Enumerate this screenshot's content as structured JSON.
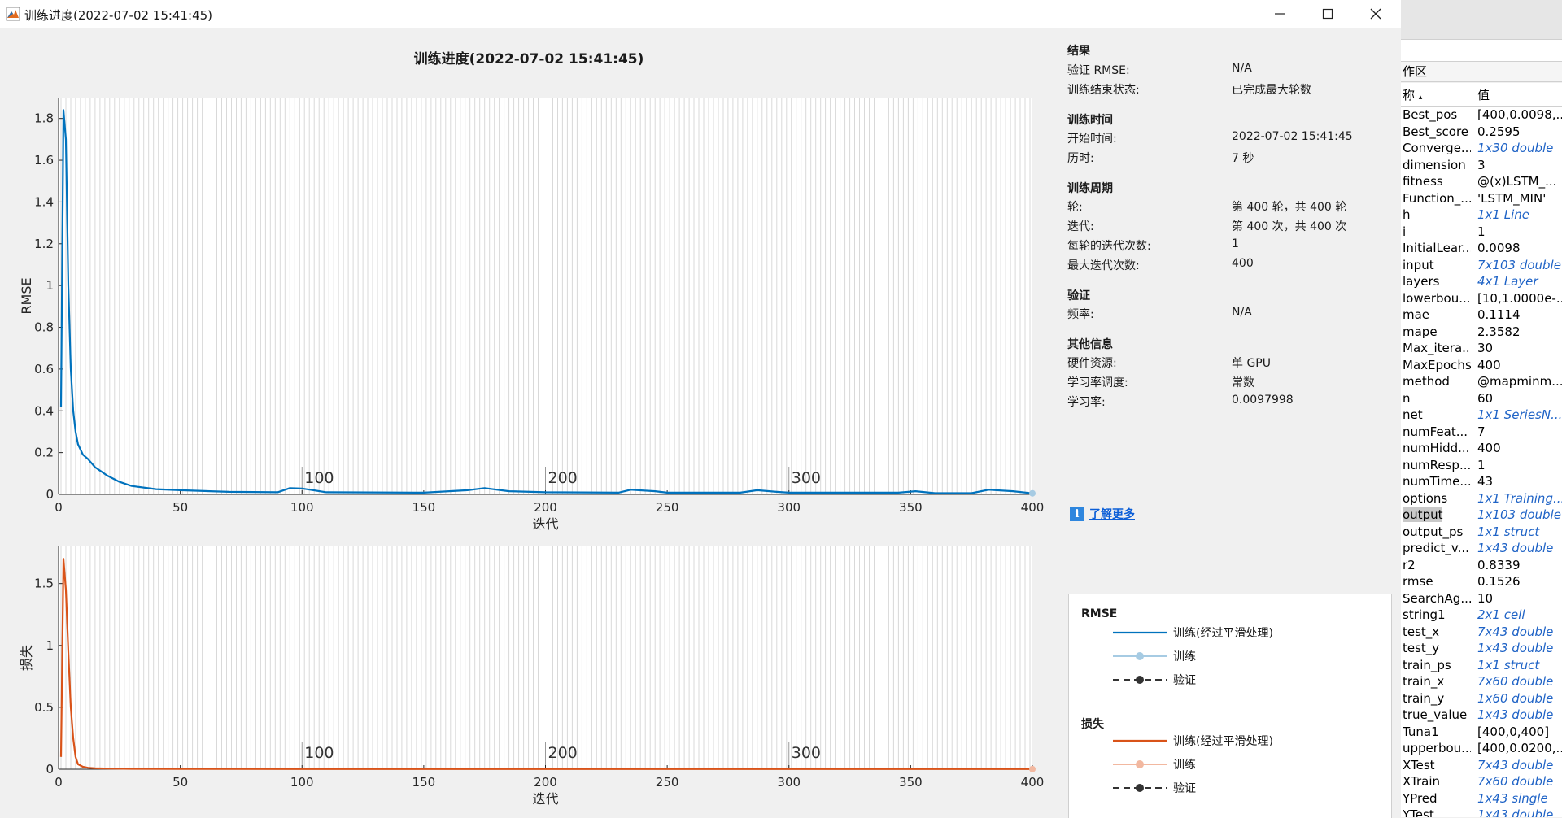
{
  "window": {
    "title": "训练进度(2022-07-02 15:41:45)",
    "controls": [
      "minimize",
      "maximize",
      "close"
    ]
  },
  "figure_title": "训练进度(2022-07-02 15:41:45)",
  "info_panel": {
    "sections": [
      {
        "title": "结果",
        "rows": [
          {
            "label": "验证 RMSE:",
            "value": "N/A"
          },
          {
            "label": "训练结束状态:",
            "value": "已完成最大轮数"
          }
        ]
      },
      {
        "title": "训练时间",
        "rows": [
          {
            "label": "开始时间:",
            "value": "2022-07-02 15:41:45"
          },
          {
            "label": "历时:",
            "value": "7 秒"
          }
        ]
      },
      {
        "title": "训练周期",
        "rows": [
          {
            "label": "轮:",
            "value": "第 400 轮，共 400 轮"
          },
          {
            "label": "迭代:",
            "value": "第 400 次，共 400 次"
          },
          {
            "label": "每轮的迭代次数:",
            "value": "1"
          },
          {
            "label": "最大迭代次数:",
            "value": "400"
          }
        ]
      },
      {
        "title": "验证",
        "rows": [
          {
            "label": "频率:",
            "value": "N/A"
          }
        ]
      },
      {
        "title": "其他信息",
        "rows": [
          {
            "label": "硬件资源:",
            "value": "单 GPU"
          },
          {
            "label": "学习率调度:",
            "value": "常数"
          },
          {
            "label": "学习率:",
            "value": "0.0097998"
          }
        ]
      }
    ],
    "learn_more": "了解更多"
  },
  "legend": {
    "groups": [
      {
        "title": "RMSE",
        "items": [
          {
            "label": "训练(经过平滑处理)",
            "style": "line",
            "color": "#0072bd"
          },
          {
            "label": "训练",
            "style": "line-marker",
            "color": "#a6cbe3"
          },
          {
            "label": "验证",
            "style": "dashed-marker",
            "color": "#333333"
          }
        ]
      },
      {
        "title": "损失",
        "items": [
          {
            "label": "训练(经过平滑处理)",
            "style": "line",
            "color": "#d95319"
          },
          {
            "label": "训练",
            "style": "line-marker",
            "color": "#f2b8a0"
          },
          {
            "label": "验证",
            "style": "dashed-marker",
            "color": "#333333"
          }
        ]
      }
    ]
  },
  "chart_data": [
    {
      "type": "line",
      "ylabel": "RMSE",
      "xlabel": "迭代",
      "xlim": [
        0,
        400
      ],
      "ylim": [
        0,
        1.9
      ],
      "xticks": [
        0,
        50,
        100,
        150,
        200,
        250,
        300,
        350,
        400
      ],
      "yticks": [
        0,
        0.2,
        0.4,
        0.6,
        0.8,
        1,
        1.2,
        1.4,
        1.6,
        1.8
      ],
      "ytick_labels": [
        "0",
        "0.2",
        "0.4",
        "0.6",
        "0.8",
        "1",
        "1.2",
        "1.4",
        "1.6",
        "1.8"
      ],
      "epoch_markers": [
        {
          "x": 100,
          "label": "100"
        },
        {
          "x": 200,
          "label": "200"
        },
        {
          "x": 300,
          "label": "300"
        }
      ],
      "series": [
        {
          "name": "训练(经过平滑处理)",
          "color": "#0072bd",
          "x": [
            1,
            2,
            3,
            4,
            5,
            6,
            7,
            8,
            10,
            12,
            15,
            20,
            25,
            30,
            40,
            50,
            70,
            90,
            95,
            100,
            110,
            150,
            168,
            175,
            185,
            200,
            230,
            235,
            245,
            250,
            280,
            287,
            295,
            300,
            345,
            352,
            360,
            375,
            382,
            392,
            400
          ],
          "y": [
            0.42,
            1.84,
            1.7,
            1.0,
            0.6,
            0.4,
            0.3,
            0.24,
            0.19,
            0.17,
            0.13,
            0.09,
            0.06,
            0.04,
            0.025,
            0.02,
            0.012,
            0.01,
            0.03,
            0.028,
            0.01,
            0.008,
            0.02,
            0.03,
            0.015,
            0.01,
            0.008,
            0.022,
            0.015,
            0.008,
            0.008,
            0.02,
            0.012,
            0.008,
            0.008,
            0.015,
            0.006,
            0.006,
            0.022,
            0.015,
            0.005
          ]
        }
      ]
    },
    {
      "type": "line",
      "ylabel": "损失",
      "xlabel": "迭代",
      "xlim": [
        0,
        400
      ],
      "ylim": [
        0,
        1.8
      ],
      "xticks": [
        0,
        50,
        100,
        150,
        200,
        250,
        300,
        350,
        400
      ],
      "yticks": [
        0,
        0.5,
        1,
        1.5
      ],
      "ytick_labels": [
        "0",
        "0.5",
        "1",
        "1.5"
      ],
      "epoch_markers": [
        {
          "x": 100,
          "label": "100"
        },
        {
          "x": 200,
          "label": "200"
        },
        {
          "x": 300,
          "label": "300"
        }
      ],
      "series": [
        {
          "name": "训练(经过平滑处理)",
          "color": "#d95319",
          "x": [
            1,
            2,
            3,
            4,
            5,
            6,
            7,
            8,
            10,
            12,
            15,
            20,
            30,
            50,
            400
          ],
          "y": [
            0.1,
            1.7,
            1.45,
            0.95,
            0.5,
            0.25,
            0.1,
            0.04,
            0.02,
            0.012,
            0.008,
            0.005,
            0.003,
            0.002,
            0.001
          ]
        }
      ]
    }
  ],
  "workspace": {
    "title": "作区",
    "col_name": "称",
    "col_value": "值",
    "variables": [
      {
        "name": "Best_pos",
        "value": "[400,0.0098,...",
        "class_ref": false
      },
      {
        "name": "Best_score",
        "value": "0.2595",
        "class_ref": false
      },
      {
        "name": "Converge...",
        "value": "1x30 double",
        "class_ref": true
      },
      {
        "name": "dimension",
        "value": "3",
        "class_ref": false
      },
      {
        "name": "fitness",
        "value": "@(x)LSTM_...",
        "class_ref": false
      },
      {
        "name": "Function_...",
        "value": "'LSTM_MIN'",
        "class_ref": false
      },
      {
        "name": "h",
        "value": "1x1 Line",
        "class_ref": true
      },
      {
        "name": "i",
        "value": "1",
        "class_ref": false
      },
      {
        "name": "InitialLear...",
        "value": "0.0098",
        "class_ref": false
      },
      {
        "name": "input",
        "value": "7x103 double",
        "class_ref": true
      },
      {
        "name": "layers",
        "value": "4x1 Layer",
        "class_ref": true
      },
      {
        "name": "lowerbou...",
        "value": "[10,1.0000e-...",
        "class_ref": false
      },
      {
        "name": "mae",
        "value": "0.1114",
        "class_ref": false
      },
      {
        "name": "mape",
        "value": "2.3582",
        "class_ref": false
      },
      {
        "name": "Max_itera...",
        "value": "30",
        "class_ref": false
      },
      {
        "name": "MaxEpochs",
        "value": "400",
        "class_ref": false
      },
      {
        "name": "method",
        "value": "@mapminm...",
        "class_ref": false
      },
      {
        "name": "n",
        "value": "60",
        "class_ref": false
      },
      {
        "name": "net",
        "value": "1x1 SeriesN...",
        "class_ref": true
      },
      {
        "name": "numFeat...",
        "value": "7",
        "class_ref": false
      },
      {
        "name": "numHidd...",
        "value": "400",
        "class_ref": false
      },
      {
        "name": "numResp...",
        "value": "1",
        "class_ref": false
      },
      {
        "name": "numTime...",
        "value": "43",
        "class_ref": false
      },
      {
        "name": "options",
        "value": "1x1 Training...",
        "class_ref": true
      },
      {
        "name": "output",
        "value": "1x103 double",
        "class_ref": true,
        "selected": true
      },
      {
        "name": "output_ps",
        "value": "1x1 struct",
        "class_ref": true
      },
      {
        "name": "predict_v...",
        "value": "1x43 double",
        "class_ref": true
      },
      {
        "name": "r2",
        "value": "0.8339",
        "class_ref": false
      },
      {
        "name": "rmse",
        "value": "0.1526",
        "class_ref": false
      },
      {
        "name": "SearchAg...",
        "value": "10",
        "class_ref": false
      },
      {
        "name": "string1",
        "value": "2x1 cell",
        "class_ref": true
      },
      {
        "name": "test_x",
        "value": "7x43 double",
        "class_ref": true
      },
      {
        "name": "test_y",
        "value": "1x43 double",
        "class_ref": true
      },
      {
        "name": "train_ps",
        "value": "1x1 struct",
        "class_ref": true
      },
      {
        "name": "train_x",
        "value": "7x60 double",
        "class_ref": true
      },
      {
        "name": "train_y",
        "value": "1x60 double",
        "class_ref": true
      },
      {
        "name": "true_value",
        "value": "1x43 double",
        "class_ref": true
      },
      {
        "name": "Tuna1",
        "value": "[400,0,400]",
        "class_ref": false
      },
      {
        "name": "upperbou...",
        "value": "[400,0.0200,...",
        "class_ref": false
      },
      {
        "name": "XTest",
        "value": "7x43 double",
        "class_ref": true
      },
      {
        "name": "XTrain",
        "value": "7x60 double",
        "class_ref": true
      },
      {
        "name": "YPred",
        "value": "1x43 single",
        "class_ref": true
      },
      {
        "name": "YTest",
        "value": "1x43 double",
        "class_ref": true
      }
    ]
  }
}
